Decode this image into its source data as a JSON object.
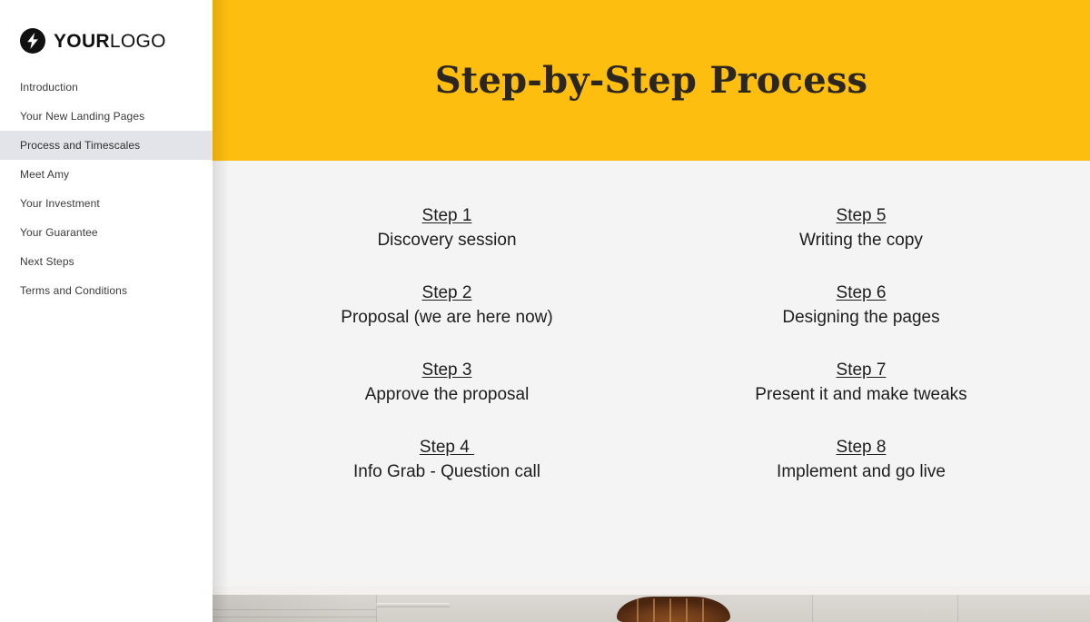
{
  "sidebar": {
    "logo": {
      "icon": "lightning-bolt-icon",
      "bold_part": "YOUR",
      "light_part": "LOGO"
    },
    "items": [
      {
        "label": "Introduction",
        "active": false
      },
      {
        "label": "Your New Landing Pages",
        "active": false
      },
      {
        "label": "Process and Timescales",
        "active": true
      },
      {
        "label": "Meet Amy",
        "active": false
      },
      {
        "label": "Your Investment",
        "active": false
      },
      {
        "label": "Your Guarantee",
        "active": false
      },
      {
        "label": "Next Steps",
        "active": false
      },
      {
        "label": "Terms and Conditions",
        "active": false
      }
    ],
    "active_index": 2
  },
  "banner": {
    "title": "Step-by-Step Process",
    "background_color": "#FEBE10",
    "text_color": "#2C2620"
  },
  "main": {
    "background_color": "#F4F4F4",
    "steps": [
      {
        "title": "Step 1",
        "description": "Discovery session"
      },
      {
        "title": "Step 5",
        "description": "Writing the copy"
      },
      {
        "title": "Step 2",
        "description": "Proposal (we are here now)"
      },
      {
        "title": "Step 6",
        "description": "Designing the pages"
      },
      {
        "title": "Step 3",
        "description": "Approve the proposal"
      },
      {
        "title": "Step 7",
        "description": "Present it and make tweaks"
      },
      {
        "title": "Step 4 ",
        "description": "Info Grab - Question call"
      },
      {
        "title": "Step 8",
        "description": "Implement and go live"
      }
    ]
  },
  "photo": {
    "caption": "kitchen-interior-photo"
  }
}
